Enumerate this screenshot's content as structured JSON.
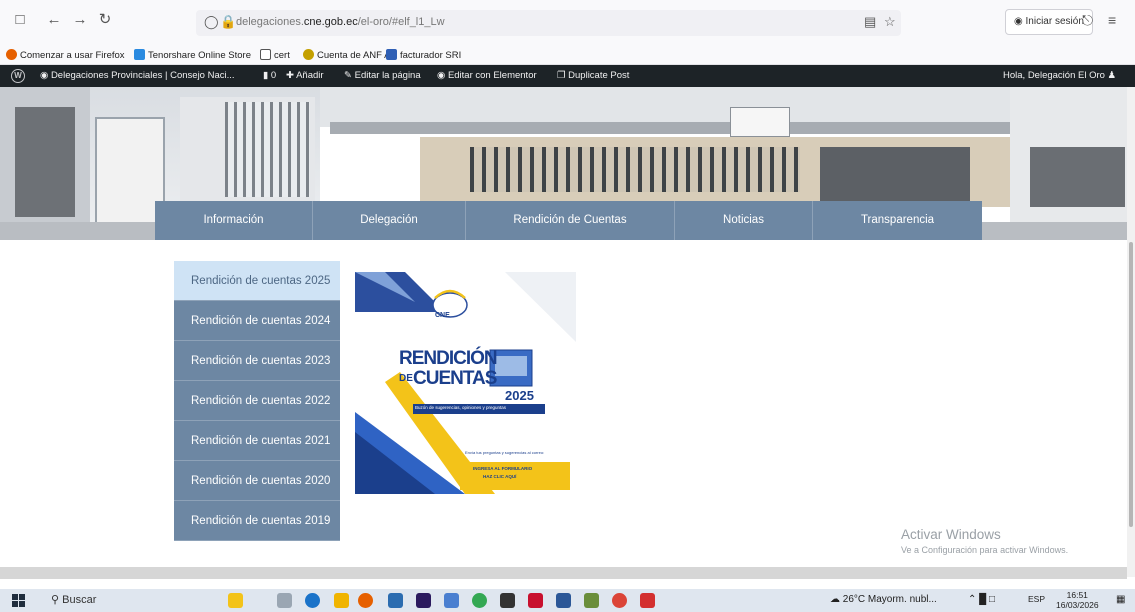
{
  "browser": {
    "url_prefix": "delegaciones.",
    "url_domain": "cne.gob.ec",
    "url_path": "/el-oro/#elf_l1_Lw",
    "signin_label": "Iniciar sesión"
  },
  "bookmarks": [
    {
      "label": "Comenzar a usar Firefox",
      "color": "#e66000"
    },
    {
      "label": "Tenorshare Online Store",
      "color": "#2a8ae0"
    },
    {
      "label": "cert",
      "color": "#ffffff"
    },
    {
      "label": "Cuenta de ANF AC",
      "color": "#c4a000"
    },
    {
      "label": "facturador SRI",
      "color": "#2f5fb5"
    }
  ],
  "adminbar": {
    "site": "Delegaciones Provinciales | Consejo Naci...",
    "comments": "0",
    "add": "Añadir",
    "edit_page": "Editar la página",
    "elementor": "Editar con Elementor",
    "duplicate": "Duplicate Post",
    "greeting": "Hola, Delegación El Oro"
  },
  "nav": [
    {
      "label": "Información"
    },
    {
      "label": "Delegación"
    },
    {
      "label": "Rendición de Cuentas"
    },
    {
      "label": "Noticias"
    },
    {
      "label": "Transparencia"
    }
  ],
  "sidebar": [
    {
      "label": "Rendición de cuentas 2025",
      "active": true
    },
    {
      "label": "Rendición de cuentas 2024"
    },
    {
      "label": "Rendición de cuentas 2023"
    },
    {
      "label": "Rendición de cuentas 2022"
    },
    {
      "label": "Rendición de cuentas 2021"
    },
    {
      "label": "Rendición de cuentas 2020"
    },
    {
      "label": "Rendición de cuentas 2019"
    }
  ],
  "poster": {
    "logo": "CNE",
    "title1": "RENDICIÓN",
    "title2": "DE",
    "title3": "CUENTAS",
    "year": "2025",
    "banner": "Buzón de sugerencias, opiniones y preguntas",
    "footer1": "Envía tus preguntas y sugerencias al correo:",
    "footer2": "INGRESA AL FORMULARIO",
    "footer3": "HAZ CLIC AQUÍ"
  },
  "watermark": {
    "title": "Activar Windows",
    "subtitle": "Ve a Configuración para activar Windows."
  },
  "taskbar": {
    "search": "Buscar",
    "weather": "26°C  Mayorm. nubl...",
    "lang": "ESP",
    "time": "16:51",
    "date": "16/03/2026"
  },
  "colors": {
    "nav_bg": "#6d87a3",
    "active_bg": "#cfe3f5",
    "admin_bg": "#1d2327"
  }
}
